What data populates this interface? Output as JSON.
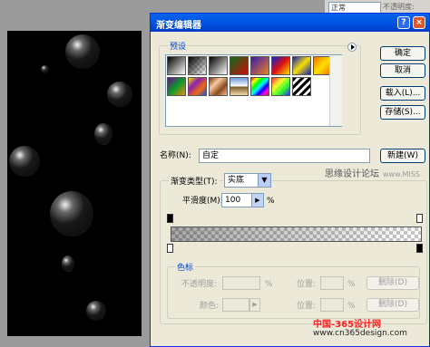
{
  "background_app": {
    "blend_mode": "正常",
    "opacity_label": "不透明度:"
  },
  "dialog": {
    "title": "渐变编辑器",
    "presets_label": "预设",
    "presets_menu_icon": "triangle-right-icon",
    "buttons": {
      "ok": "确定",
      "cancel": "取消",
      "load": "载入(L)...",
      "save": "存储(S)...",
      "new": "新建(W)"
    },
    "name_label": "名称(N):",
    "name_value": "自定",
    "gradient_type_label": "渐变类型(T):",
    "gradient_type_value": "实底",
    "smoothness_label": "平滑度(M):",
    "smoothness_value": "100",
    "smoothness_unit": "%",
    "color_stops": {
      "section_label": "色标",
      "opacity_label": "不透明度:",
      "opacity_unit": "%",
      "location_label": "位置:",
      "location_unit": "%",
      "delete_label": "删除(D)",
      "color_label": "颜色:"
    }
  },
  "watermarks": {
    "line1": "思缘设计论坛",
    "line1_tail": "www.MISS",
    "site_name": "中国-365设计网",
    "site_url": "www.cn365design.com"
  }
}
